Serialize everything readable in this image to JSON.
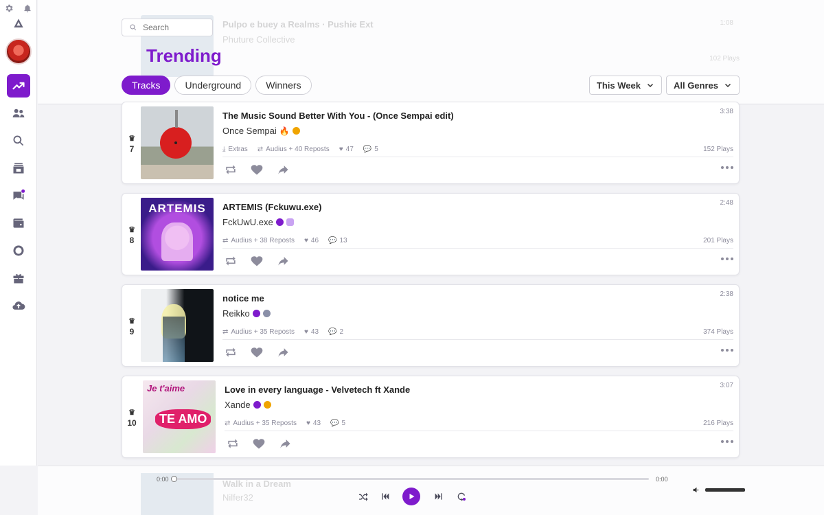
{
  "header": {
    "title": "Trending",
    "search_placeholder": "Search",
    "ghost_title": "Pulpo e buey a Realms · Pushie Ext",
    "ghost_artist": "Phuture Collective",
    "ghost_plays": "102 Plays",
    "ghost_dur": "1:08"
  },
  "tabs": [
    {
      "label": "Tracks",
      "active": true
    },
    {
      "label": "Underground",
      "active": false
    },
    {
      "label": "Winners",
      "active": false
    }
  ],
  "filters": {
    "period": "This Week",
    "genre": "All Genres"
  },
  "tracks": [
    {
      "rank": "7",
      "title": "The Music Sound Better With You - (Once Sempai edit)",
      "artist": "Once Sempai",
      "extras": "Extras",
      "reposts": "Audius + 40 Reposts",
      "likes": "47",
      "comments": "5",
      "duration": "3:38",
      "plays": "152 Plays"
    },
    {
      "rank": "8",
      "title": "ARTEMIS (Fckuwu.exe)",
      "artist": "FckUwU.exe",
      "reposts": "Audius + 38 Reposts",
      "likes": "46",
      "comments": "13",
      "duration": "2:48",
      "plays": "201 Plays",
      "art_text": "ARTEMIS"
    },
    {
      "rank": "9",
      "title": "notice me",
      "artist": "Reikko",
      "reposts": "Audius + 35 Reposts",
      "likes": "43",
      "comments": "2",
      "duration": "2:38",
      "plays": "374 Plays"
    },
    {
      "rank": "10",
      "title": "Love in every language - Velvetech ft Xande",
      "artist": "Xande",
      "reposts": "Audius + 35 Reposts",
      "likes": "43",
      "comments": "5",
      "duration": "3:07",
      "plays": "216 Plays",
      "art_text": "TE AMO",
      "art_text2": "Je t'aime"
    }
  ],
  "player": {
    "elapsed": "0:00",
    "total": "0:00",
    "ghost_title": "Walk in a Dream",
    "ghost_artist": "Nilfer32"
  },
  "colors": {
    "accent": "#7e1bcc",
    "text": "#333333",
    "muted": "#8d8c9c"
  }
}
